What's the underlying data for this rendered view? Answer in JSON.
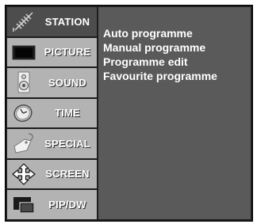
{
  "menu": {
    "items": [
      {
        "label": "STATION",
        "icon": "antenna-icon",
        "active": true
      },
      {
        "label": "PICTURE",
        "icon": "tv-screen-icon",
        "active": false
      },
      {
        "label": "SOUND",
        "icon": "speaker-icon",
        "active": false
      },
      {
        "label": "TIME",
        "icon": "clock-icon",
        "active": false
      },
      {
        "label": "SPECIAL",
        "icon": "tag-icon",
        "active": false
      },
      {
        "label": "SCREEN",
        "icon": "move-arrows-icon",
        "active": false
      },
      {
        "label": "PIP/DW",
        "icon": "pip-icon",
        "active": false
      }
    ]
  },
  "submenu": {
    "items": [
      "Auto programme",
      "Manual programme",
      "Programme edit",
      "Favourite programme"
    ]
  },
  "colors": {
    "active_item": "#4d4d4d",
    "inactive_item": "#b3b3b3",
    "content_panel": "#5a5a5a",
    "frame": "#1d1d1d",
    "text": "#ffffff"
  }
}
